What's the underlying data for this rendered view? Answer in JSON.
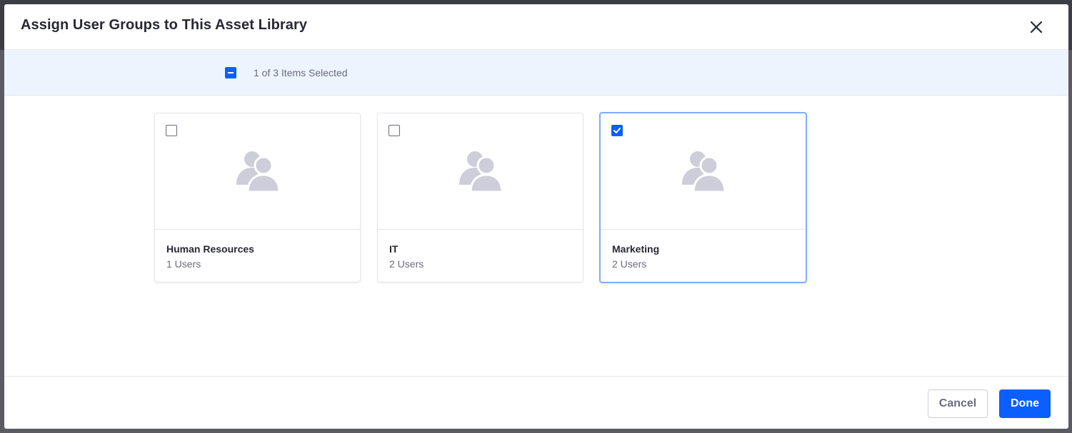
{
  "modal": {
    "title": "Assign User Groups to This Asset Library",
    "close_icon": "close-icon"
  },
  "management_bar": {
    "selection_text": "1 of 3 Items Selected",
    "bulk_checkbox_state": "indeterminate"
  },
  "cards": [
    {
      "title": "Human Resources",
      "subtitle": "1 Users",
      "checked": false,
      "icon": "users-icon"
    },
    {
      "title": "IT",
      "subtitle": "2 Users",
      "checked": false,
      "icon": "users-icon"
    },
    {
      "title": "Marketing",
      "subtitle": "2 Users",
      "checked": true,
      "icon": "users-icon"
    }
  ],
  "footer": {
    "cancel_label": "Cancel",
    "done_label": "Done"
  },
  "colors": {
    "primary": "#0b5fff",
    "management_bar_bg": "#eef4fe",
    "selected_border": "#80acff",
    "icon_gray": "#cdced9"
  }
}
